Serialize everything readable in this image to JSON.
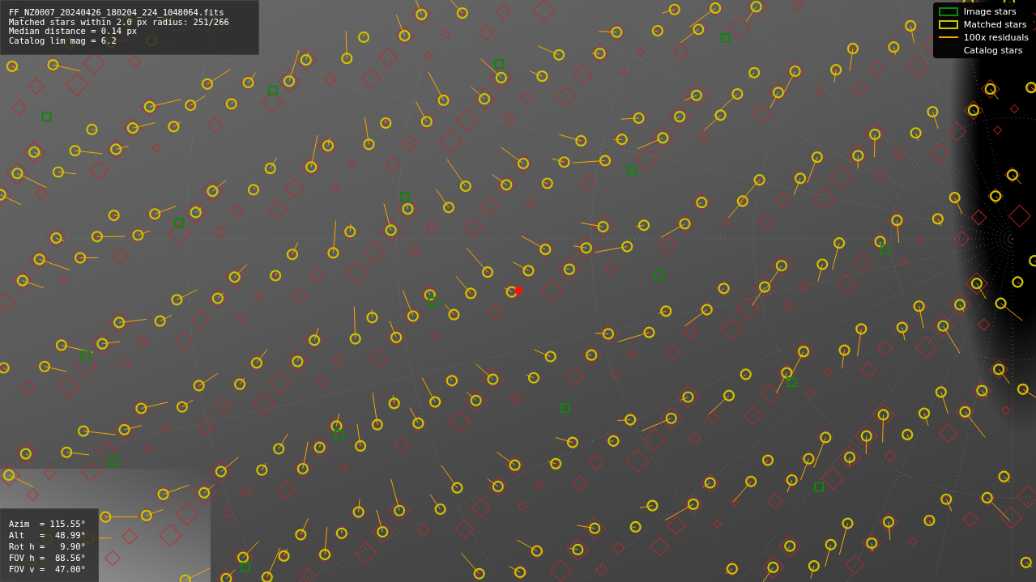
{
  "info_box": {
    "lines": [
      "FF_NZ0007_20240426_180204_224_1048064.fits",
      "Matched stars within 2.0 px radius: 251/266",
      "Median distance = 0.14 px",
      "Catalog lim mag = 6.2"
    ]
  },
  "legend": {
    "items": [
      {
        "label": "Image stars",
        "kind": "box",
        "color": "#0a8a0a"
      },
      {
        "label": "Matched stars",
        "kind": "box",
        "color": "#c8c800"
      },
      {
        "label": "100x residuals",
        "kind": "line",
        "color": "#ffa500"
      },
      {
        "label": "Catalog stars",
        "kind": "none"
      }
    ]
  },
  "pointing_box": {
    "lines": [
      "Azim  = 115.55°",
      "Alt   =  48.99°",
      "Rot h =   9.90°",
      "FOV h =  88.56°",
      "FOV v =  47.00°"
    ]
  }
}
